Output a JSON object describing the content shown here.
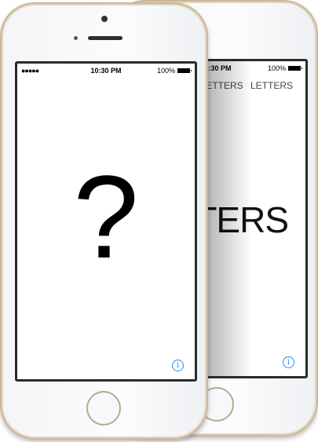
{
  "back_phone": {
    "status": {
      "time": "10:30 PM",
      "battery": "100%"
    },
    "top_row": "LETTERS LETTERS LETTERS",
    "big_text": "LETTERS",
    "info_icon": "info-icon"
  },
  "front_phone": {
    "status": {
      "signal": "●●●●●",
      "time": "10:30 PM",
      "battery": "100%"
    },
    "question": "?",
    "info_icon": "info-icon"
  },
  "colors": {
    "accent": "#1a8cff",
    "frame": "#c9b89a"
  }
}
